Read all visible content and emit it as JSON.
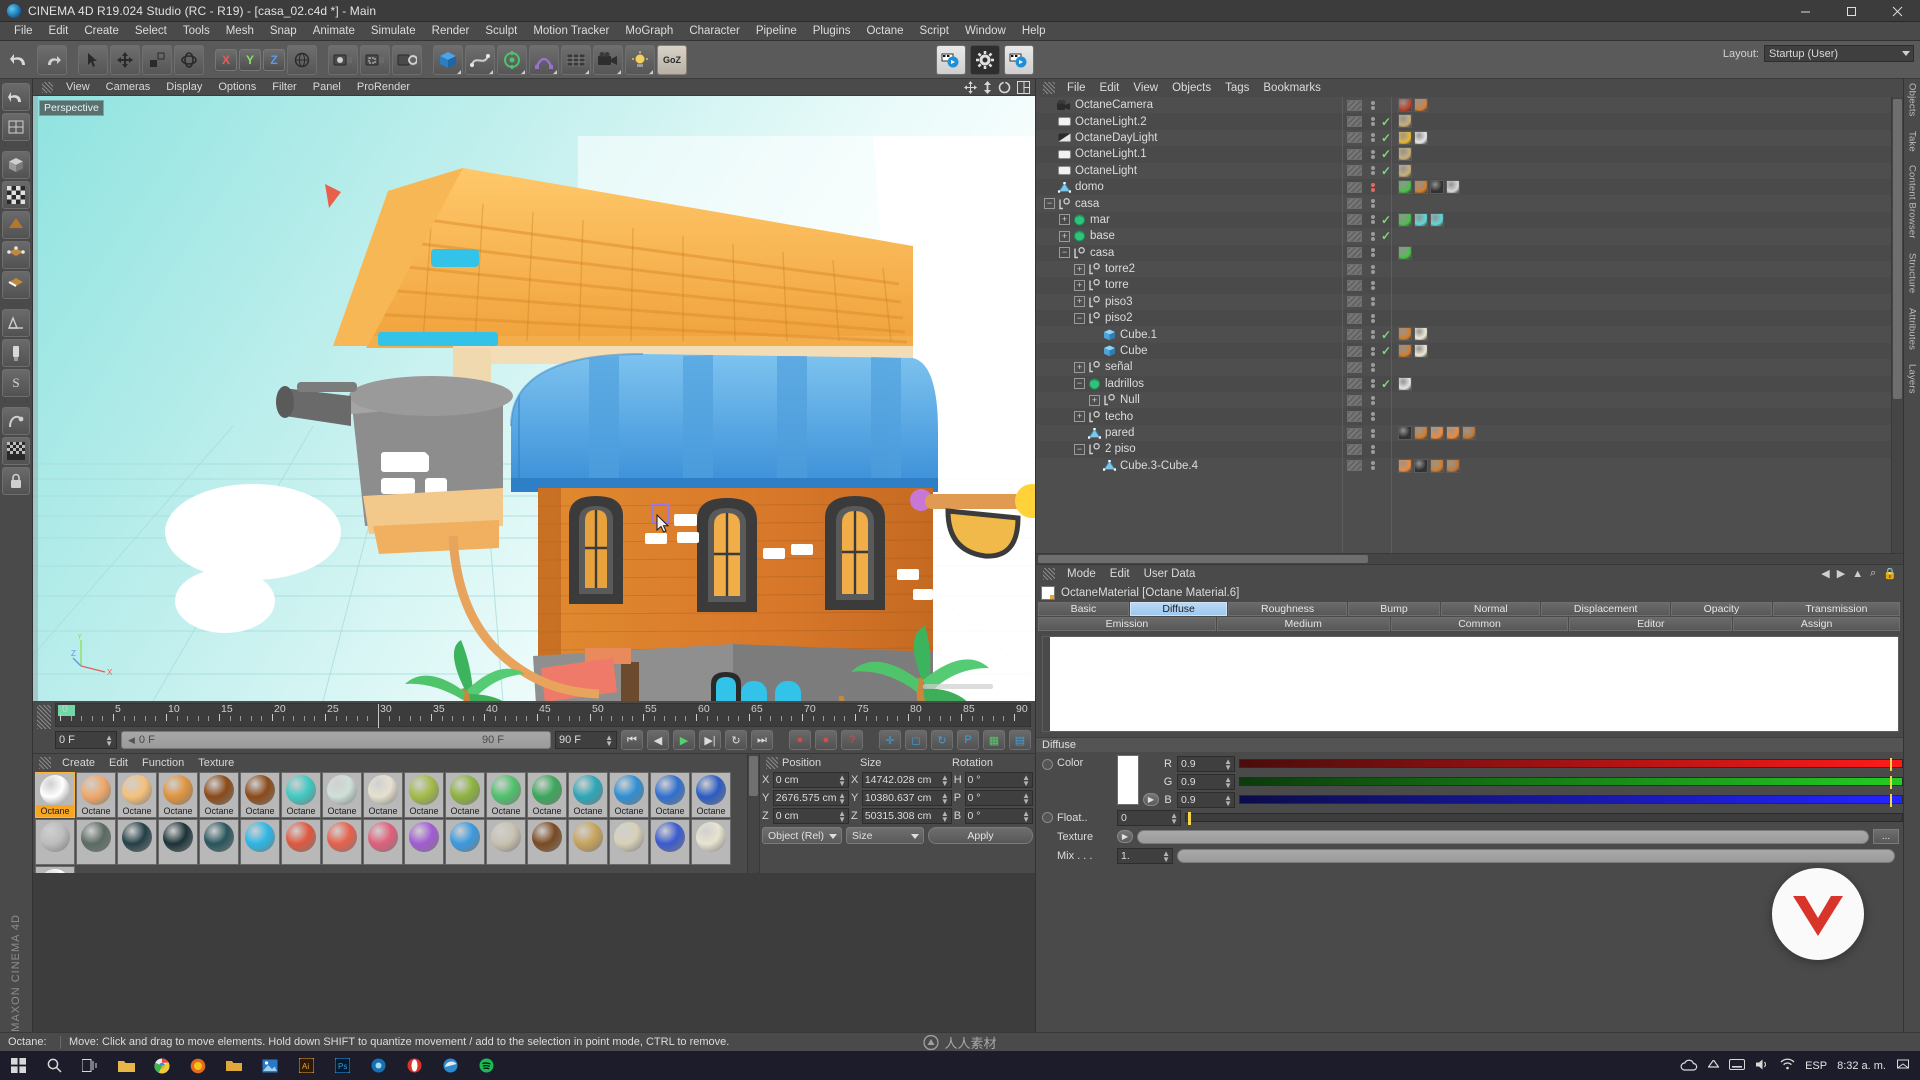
{
  "window": {
    "title": "CINEMA 4D R19.024 Studio (RC - R19) - [casa_02.c4d *] - Main",
    "minimize": "–",
    "maximize": "☐",
    "close": "✕"
  },
  "menubar": {
    "items": [
      "File",
      "Edit",
      "Create",
      "Select",
      "Tools",
      "Mesh",
      "Snap",
      "Animate",
      "Simulate",
      "Render",
      "Sculpt",
      "Motion Tracker",
      "MoGraph",
      "Character",
      "Pipeline",
      "Plugins",
      "Octane",
      "Script",
      "Window",
      "Help"
    ]
  },
  "toolbar": {
    "layout_label": "Layout:",
    "layout_value": "Startup (User)",
    "axes": [
      "X",
      "Y",
      "Z"
    ],
    "icons": [
      "undo-icon",
      "redo-icon",
      "select-live-icon",
      "move-icon",
      "scale-icon",
      "rotate-icon",
      "axis-x-icon",
      "axis-y-icon",
      "axis-z-icon",
      "world-coord-icon",
      "render-view-icon",
      "render-region-icon",
      "render-settings-icon",
      "cube-primitive-icon",
      "spline-pen-icon",
      "generator-icon",
      "deformer-icon",
      "scene-environment-icon",
      "camera-icon",
      "light-icon",
      "goz-icon",
      "octane-live-viewer-icon",
      "octane-settings-icon",
      "octane-render-icon"
    ]
  },
  "leftrail": {
    "icons": [
      "undo-arrow-icon",
      "texture-axis-icon",
      "cube-mode-icon",
      "checker-mode-icon",
      "polygon-mode-icon",
      "point-mode-icon",
      "edge-mode-icon",
      "model-mode-icon",
      "texture-mode-icon",
      "workplane-icon",
      "snap-icon",
      "enable-axis-icon",
      "lock-axis-icon"
    ],
    "brand": "MAXON CINEMA 4D"
  },
  "rightrail": {
    "labels": [
      "Objects",
      "Take",
      "Content Browser",
      "Structure",
      "Attributes",
      "Layers"
    ]
  },
  "viewport": {
    "menu": [
      "View",
      "Cameras",
      "Display",
      "Options",
      "Filter",
      "Panel",
      "ProRender"
    ],
    "label": "Perspective",
    "axis_labels": [
      "Y",
      "X",
      "Z"
    ],
    "icons": [
      "move-view-icon",
      "zoom-view-icon",
      "rotate-view-icon",
      "panel-layout-icon"
    ]
  },
  "timeline": {
    "frame_start": 0,
    "frame_end": 90,
    "current_frame": "0 F",
    "ruler_numbers": [
      0,
      5,
      10,
      15,
      20,
      25,
      30,
      35,
      40,
      45,
      50,
      55,
      60,
      65,
      70,
      75,
      80,
      85,
      90
    ],
    "left_field": "0 F",
    "track_field": "0 F",
    "range_end_label": "90 F",
    "range_field": "90 F",
    "transport": [
      "go-to-start-icon",
      "step-back-icon",
      "play-icon",
      "step-forward-icon",
      "go-to-end-icon"
    ],
    "record_buttons": [
      "record-icon",
      "autokey-icon",
      "key-help-icon"
    ],
    "key_buttons": [
      "position-key-icon",
      "scale-key-icon",
      "rotation-key-icon",
      "param-key-icon",
      "pla-key-icon",
      "timeline-icon"
    ]
  },
  "material_manager": {
    "menu": [
      "Create",
      "Edit",
      "Function",
      "Texture"
    ],
    "materials": [
      {
        "name": "Octane",
        "color": "#ffffff",
        "selected": true
      },
      {
        "name": "Octane",
        "color": "#f0a868",
        "selected": false
      },
      {
        "name": "Octane",
        "color": "#f6c07a",
        "selected": false
      },
      {
        "name": "Octane",
        "color": "#e0933c",
        "selected": false
      },
      {
        "name": "Octane",
        "color": "#8a4a18",
        "selected": false
      },
      {
        "name": "Octane",
        "color": "#8a4a18",
        "selected": false
      },
      {
        "name": "Octane",
        "color": "#3fc9c4",
        "selected": false
      },
      {
        "name": "Octane",
        "color": "#cfe0d8",
        "selected": false
      },
      {
        "name": "Octane",
        "color": "#e6e1cf",
        "selected": false
      },
      {
        "name": "Octane",
        "color": "#a2bb46",
        "selected": false
      },
      {
        "name": "Octane",
        "color": "#8db33e",
        "selected": false
      },
      {
        "name": "Octane",
        "color": "#4ec26b",
        "selected": false
      },
      {
        "name": "Octane",
        "color": "#3aa85a",
        "selected": false
      },
      {
        "name": "Octane",
        "color": "#2ba7b8",
        "selected": false
      },
      {
        "name": "Octane",
        "color": "#2e8fd4",
        "selected": false
      },
      {
        "name": "Octane",
        "color": "#2f6fd0",
        "selected": false
      },
      {
        "name": "Octane",
        "color": "#2a5cc4",
        "selected": false
      },
      {
        "name": "",
        "color": "#bdbdbd",
        "selected": false
      },
      {
        "name": "",
        "color": "#5c6b62",
        "selected": false
      },
      {
        "name": "",
        "color": "#234047",
        "selected": false
      },
      {
        "name": "",
        "color": "#1b3238",
        "selected": false
      },
      {
        "name": "",
        "color": "#27545c",
        "selected": false
      },
      {
        "name": "",
        "color": "#2bb7e8",
        "selected": false
      },
      {
        "name": "",
        "color": "#e0573e",
        "selected": false
      },
      {
        "name": "",
        "color": "#e8604a",
        "selected": false
      },
      {
        "name": "",
        "color": "#e05f7c",
        "selected": false
      },
      {
        "name": "",
        "color": "#a25bd4",
        "selected": false
      },
      {
        "name": "",
        "color": "#3a9ae0",
        "selected": false
      },
      {
        "name": "",
        "color": "#c8c2b0",
        "selected": false
      },
      {
        "name": "",
        "color": "#7a4a20",
        "selected": false
      },
      {
        "name": "",
        "color": "#c8a45c",
        "selected": false
      },
      {
        "name": "",
        "color": "#d8d0b8",
        "selected": false
      },
      {
        "name": "",
        "color": "#3a5ad0",
        "selected": false
      },
      {
        "name": "",
        "color": "#e8e4d0",
        "selected": false
      },
      {
        "name": "",
        "color": "#ffffff",
        "selected": false
      }
    ]
  },
  "coordinates": {
    "headers": [
      "Position",
      "Size",
      "Rotation"
    ],
    "rows": [
      {
        "pos_label": "X",
        "pos_value": "0 cm",
        "size_label": "X",
        "size_value": "14742.028 cm",
        "rot_label": "H",
        "rot_value": "0 °"
      },
      {
        "pos_label": "Y",
        "pos_value": "2676.575 cm",
        "size_label": "Y",
        "size_value": "10380.637 cm",
        "rot_label": "P",
        "rot_value": "0 °"
      },
      {
        "pos_label": "Z",
        "pos_value": "0 cm",
        "size_label": "Z",
        "size_value": "50315.308 cm",
        "rot_label": "B",
        "rot_value": "0 °"
      }
    ],
    "mode_select": "Object (Rel)",
    "size_select": "Size",
    "apply_button": "Apply"
  },
  "object_manager": {
    "menu": [
      "File",
      "Edit",
      "View",
      "Objects",
      "Tags",
      "Bookmarks"
    ],
    "rows": [
      {
        "name": "OctaneCamera",
        "indent": 0,
        "twisty": "none",
        "icon": "camera-icon",
        "check": "none",
        "dots": "grey",
        "tags": [
          "#c0452a",
          "#d4803c"
        ]
      },
      {
        "name": "OctaneLight.2",
        "indent": 0,
        "twisty": "none",
        "icon": "light-icon",
        "check": "on",
        "dots": "grey",
        "tags": [
          "#c8b07a"
        ]
      },
      {
        "name": "OctaneDayLight",
        "indent": 0,
        "twisty": "none",
        "icon": "daylight-icon",
        "check": "on",
        "dots": "grey",
        "tags": [
          "#e8b830",
          "#e8e8e8"
        ]
      },
      {
        "name": "OctaneLight.1",
        "indent": 0,
        "twisty": "none",
        "icon": "light-icon",
        "check": "on",
        "dots": "grey",
        "tags": [
          "#c8b07a"
        ]
      },
      {
        "name": "OctaneLight",
        "indent": 0,
        "twisty": "none",
        "icon": "light-icon",
        "check": "on",
        "dots": "grey",
        "tags": [
          "#c8b07a"
        ]
      },
      {
        "name": "domo",
        "indent": 0,
        "twisty": "none",
        "icon": "poly-icon",
        "check": "none",
        "dots": "red",
        "tags": [
          "#4cc04c",
          "#d08030",
          "#303030",
          "#d8d8d8"
        ]
      },
      {
        "name": "casa",
        "indent": 0,
        "twisty": "open",
        "icon": "null-icon",
        "check": "none",
        "dots": "grey",
        "tags": []
      },
      {
        "name": "mar",
        "indent": 1,
        "twisty": "closed",
        "icon": "green-icon",
        "check": "on",
        "dots": "grey",
        "tags": [
          "#4cc04c",
          "#5fd8d8",
          "#5fd8d8"
        ]
      },
      {
        "name": "base",
        "indent": 1,
        "twisty": "closed",
        "icon": "green-icon",
        "check": "on",
        "dots": "grey",
        "tags": []
      },
      {
        "name": "casa",
        "indent": 1,
        "twisty": "open",
        "icon": "null-icon",
        "check": "none",
        "dots": "grey",
        "tags": [
          "#4cc04c"
        ]
      },
      {
        "name": "torre2",
        "indent": 2,
        "twisty": "closed",
        "icon": "null-icon",
        "check": "none",
        "dots": "grey",
        "tags": []
      },
      {
        "name": "torre",
        "indent": 2,
        "twisty": "closed",
        "icon": "null-icon",
        "check": "none",
        "dots": "grey",
        "tags": []
      },
      {
        "name": "piso3",
        "indent": 2,
        "twisty": "closed",
        "icon": "null-icon",
        "check": "none",
        "dots": "grey",
        "tags": []
      },
      {
        "name": "piso2",
        "indent": 2,
        "twisty": "open",
        "icon": "null-icon",
        "check": "none",
        "dots": "grey",
        "tags": []
      },
      {
        "name": "Cube.1",
        "indent": 3,
        "twisty": "none",
        "icon": "cube-icon",
        "check": "on",
        "dots": "grey",
        "tags": [
          "#d08030",
          "#f0ead8"
        ]
      },
      {
        "name": "Cube",
        "indent": 3,
        "twisty": "none",
        "icon": "cube-icon",
        "check": "on",
        "dots": "grey",
        "tags": [
          "#d08030",
          "#f0ead8"
        ]
      },
      {
        "name": "señal",
        "indent": 2,
        "twisty": "closed",
        "icon": "null-icon",
        "check": "none",
        "dots": "grey",
        "tags": []
      },
      {
        "name": "ladrillos",
        "indent": 2,
        "twisty": "open",
        "icon": "green-icon",
        "check": "on",
        "dots": "grey",
        "tags": [
          "#e6e6e2"
        ]
      },
      {
        "name": "Null",
        "indent": 3,
        "twisty": "closed",
        "icon": "null-icon",
        "check": "none",
        "dots": "grey",
        "tags": []
      },
      {
        "name": "techo",
        "indent": 2,
        "twisty": "closed",
        "icon": "null-icon",
        "check": "none",
        "dots": "grey",
        "tags": []
      },
      {
        "name": "pared",
        "indent": 2,
        "twisty": "none",
        "icon": "poly-icon",
        "check": "none",
        "dots": "grey",
        "tags": [
          "#303030",
          "#d08030",
          "#f08a3c",
          "#f08a3c",
          "#c07a3c"
        ]
      },
      {
        "name": "2 piso",
        "indent": 2,
        "twisty": "open",
        "icon": "null-icon",
        "check": "none",
        "dots": "grey",
        "tags": []
      },
      {
        "name": "Cube.3-Cube.4",
        "indent": 3,
        "twisty": "none",
        "icon": "poly-icon",
        "check": "none",
        "dots": "grey",
        "tags": [
          "#f08a3c",
          "#303030",
          "#d08030",
          "#c07a3c"
        ]
      }
    ]
  },
  "attribute_manager": {
    "menu": [
      "Mode",
      "Edit",
      "User Data"
    ],
    "title": "OctaneMaterial [Octane Material.6]",
    "tabs_row1": [
      "Basic",
      "Diffuse",
      "Roughness",
      "Bump",
      "Normal",
      "Displacement",
      "Opacity",
      "Transmission"
    ],
    "tabs_row2": [
      "Emission",
      "Medium",
      "Common",
      "Editor",
      "Assign"
    ],
    "active_tab": "Diffuse",
    "section_title": "Diffuse",
    "color_label": "Color",
    "channels": [
      {
        "label": "R",
        "value": "0.9",
        "from": "#4a0c0c",
        "to": "#ff1a1a"
      },
      {
        "label": "G",
        "value": "0.9",
        "from": "#0c3a0c",
        "to": "#22cc22"
      },
      {
        "label": "B",
        "value": "0.9",
        "from": "#0c0c4a",
        "to": "#2424ff"
      }
    ],
    "float_label": "Float..",
    "float_value": "0",
    "texture_label": "Texture",
    "mix_label": "Mix . . .",
    "mix_value": "1.",
    "dots_button": "..."
  },
  "statusbar": {
    "prefix": "Octane:",
    "message": "Move: Click and drag to move elements. Hold down SHIFT to quantize movement / add to the selection in point mode, CTRL to remove.",
    "watermark": "人人素材"
  },
  "taskbar": {
    "language": "ESP",
    "time": "8:32 a. m.",
    "icons": [
      "start-icon",
      "search-icon",
      "task-view-icon",
      "explorer-icon",
      "chrome-icon",
      "firefox-icon",
      "folder-icon",
      "photos-icon",
      "ai-icon",
      "ps-icon",
      "illustrator-icon",
      "opera-icon",
      "c4d-icon",
      "edge-icon",
      "spotify-icon",
      "show-hidden-icon",
      "cloud-icon",
      "keyboard-icon",
      "volume-icon",
      "wifi-icon",
      "notification-icon"
    ]
  }
}
